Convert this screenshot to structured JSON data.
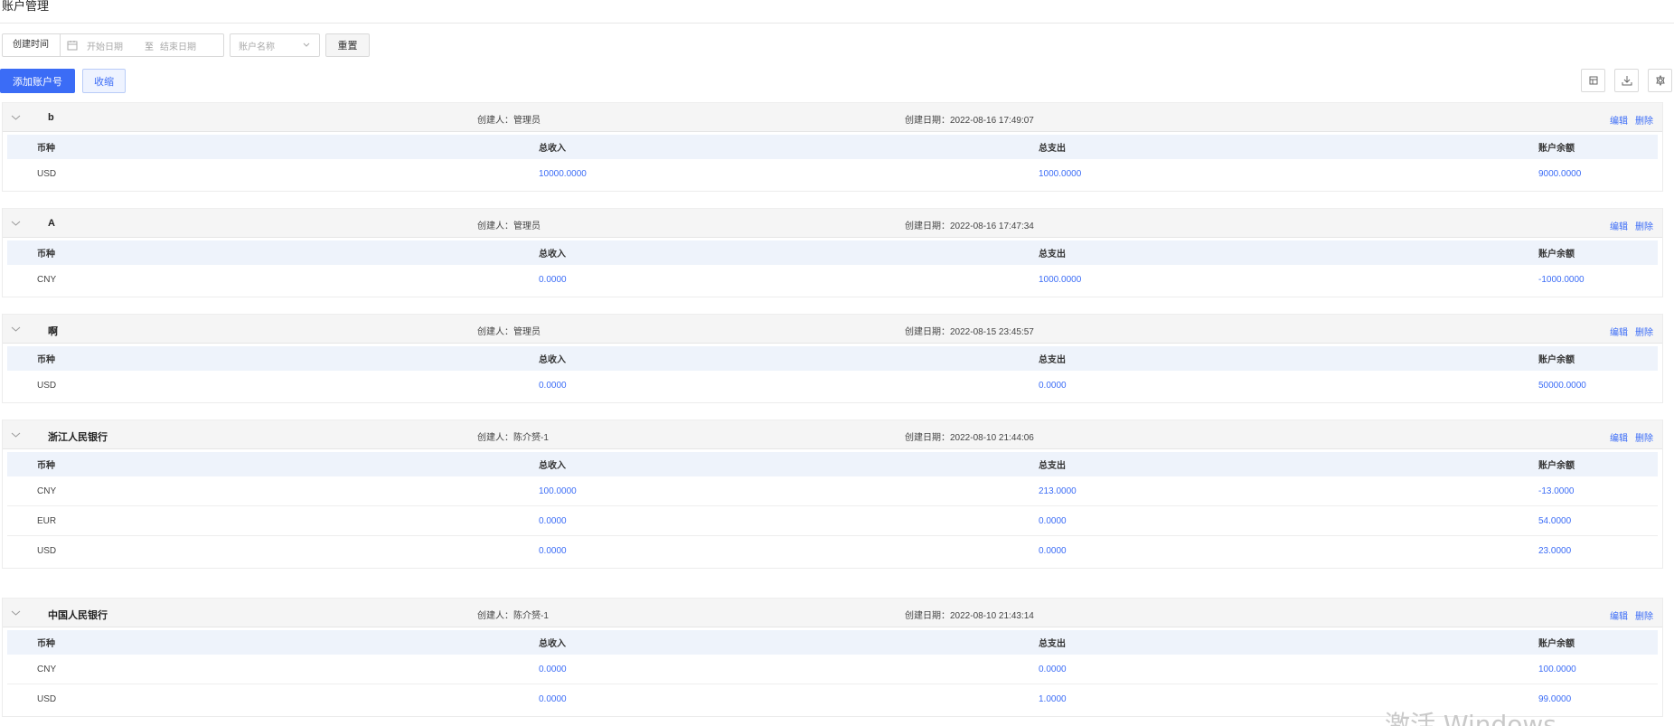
{
  "page": {
    "title": "账户管理"
  },
  "filters": {
    "range_label": "创建时间",
    "start_placeholder": "开始日期",
    "range_separator": "至",
    "end_placeholder": "结束日期",
    "account_name_placeholder": "账户名称",
    "reset_label": "重置"
  },
  "toolbar": {
    "add_label": "添加账户号",
    "collapse_label": "收缩",
    "icons": [
      "table-view-icon",
      "export-icon",
      "settings-icon"
    ]
  },
  "columns": [
    "币种",
    "总收入",
    "总支出",
    "账户余额"
  ],
  "actions": {
    "edit": "编辑",
    "delete": "删除"
  },
  "accounts": [
    {
      "name": "b",
      "creator": "创建人：管理员",
      "created": "创建日期：2022-08-16 17:49:07",
      "rows": [
        [
          "USD",
          "10000.0000",
          "1000.0000",
          "9000.0000"
        ]
      ]
    },
    {
      "name": "A",
      "creator": "创建人：管理员",
      "created": "创建日期：2022-08-16 17:47:34",
      "rows": [
        [
          "CNY",
          "0.0000",
          "1000.0000",
          "-1000.0000"
        ]
      ]
    },
    {
      "name": "啊",
      "creator": "创建人：管理员",
      "created": "创建日期：2022-08-15 23:45:57",
      "rows": [
        [
          "USD",
          "0.0000",
          "0.0000",
          "50000.0000"
        ]
      ]
    },
    {
      "name": "浙江人民银行",
      "creator": "创建人：陈介赟-1",
      "created": "创建日期：2022-08-10 21:44:06",
      "rows": [
        [
          "CNY",
          "100.0000",
          "213.0000",
          "-13.0000"
        ],
        [
          "EUR",
          "0.0000",
          "0.0000",
          "54.0000"
        ],
        [
          "USD",
          "0.0000",
          "0.0000",
          "23.0000"
        ]
      ]
    },
    {
      "name": "中国人民银行",
      "creator": "创建人：陈介赟-1",
      "created": "创建日期：2022-08-10 21:43:14",
      "rows": [
        [
          "CNY",
          "0.0000",
          "0.0000",
          "100.0000"
        ],
        [
          "USD",
          "0.0000",
          "1.0000",
          "99.0000"
        ]
      ]
    }
  ],
  "watermark": "激活 Windows"
}
